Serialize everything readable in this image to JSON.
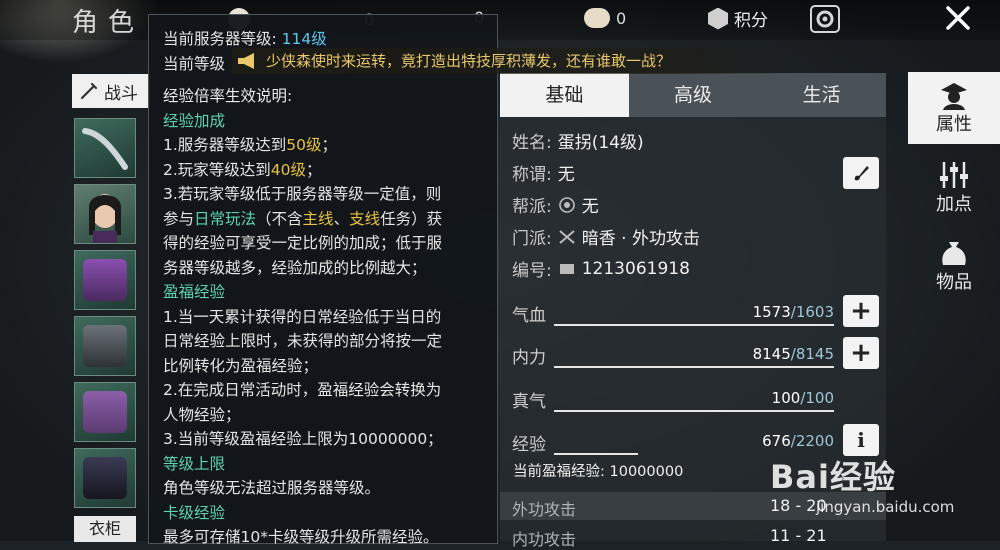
{
  "header": {
    "title": "角色",
    "resources": [
      {
        "name": "currency-1",
        "value": "0"
      },
      {
        "name": "currency-2",
        "value": "0"
      },
      {
        "name": "currency-3",
        "value": "0"
      }
    ],
    "jifen_label": "积分",
    "icons": {
      "points": "hexagon-icon",
      "settings": "gear-icon",
      "close": "close-icon"
    }
  },
  "left": {
    "battle_tab": "战斗",
    "wardrobe": "衣柜",
    "slots": [
      "weapon",
      "portrait",
      "headgear",
      "armor",
      "pants",
      "boots"
    ]
  },
  "banner": {
    "text": "少侠森使时来运转，竟打造出特技厚积薄发，还有谁敢一战？"
  },
  "tooltip": {
    "server_level_label": "当前服务器等级: ",
    "server_level_value": "114级",
    "current_level_label": "当前等级",
    "exp_title": "经验倍率生效说明:",
    "sections": {
      "bonus_title": "经验加成",
      "bonus_1_pre": "1.服务器等级达到",
      "bonus_1_val": "50级",
      "bonus_1_post": "；",
      "bonus_2_pre": "2.玩家等级达到",
      "bonus_2_val": "40级",
      "bonus_2_post": "；",
      "bonus_3_a": "3.若玩家等级低于服务器等级一定值，则",
      "bonus_3_b_pre": "参与",
      "bonus_3_b_hl1": "日常玩法",
      "bonus_3_b_mid": "（不含",
      "bonus_3_b_hl2": "主线",
      "bonus_3_b_sep": "、",
      "bonus_3_b_hl3": "支线",
      "bonus_3_b_post": "任务）获",
      "bonus_3_c": "得的经验可享受一定比例的加成；低于服",
      "bonus_3_d": "务器等级越多，经验加成的比例越大；",
      "yingfu_title": "盈福经验",
      "yingfu_1a": "1.当一天累计获得的日常经验低于当日的",
      "yingfu_1b": "日常经验上限时，未获得的部分将按一定",
      "yingfu_1c": "比例转化为盈福经验；",
      "yingfu_2a": "2.在完成日常活动时，盈福经验会转换为",
      "yingfu_2b": "人物经验；",
      "yingfu_3": "3.当前等级盈福经验上限为10000000；",
      "cap_title": "等级上限",
      "cap_text": "角色等级无法超过服务器等级。",
      "card_title": "卡级经验",
      "card_text": "最多可存储10*卡级等级升级所需经验。"
    }
  },
  "tabs": [
    "基础",
    "高级",
    "生活"
  ],
  "profile": {
    "name_label": "姓名: ",
    "name_value": "蛋拐(14级)",
    "title_label": "称谓: ",
    "title_value": "无",
    "guild_label": "帮派: ",
    "guild_value": "无",
    "sect_label": "门派: ",
    "sect_value": "暗香 · 外功攻击",
    "id_label": "编号: ",
    "id_value": "1213061918"
  },
  "stats": [
    {
      "label": "气血",
      "current": "1573",
      "max": "/1603",
      "button": "+"
    },
    {
      "label": "内力",
      "current": "8145",
      "max": "/8145",
      "button": "+"
    },
    {
      "label": "真气",
      "current": "100",
      "max": "/100"
    },
    {
      "label": "经验",
      "current": "676",
      "max": "/2200",
      "button": "i"
    }
  ],
  "bonus_exp": "当前盈福经验: 10000000",
  "attack_rows": [
    {
      "label": "外功攻击",
      "value": "18 - 20"
    },
    {
      "label": "内功攻击",
      "value": "11 - 21"
    }
  ],
  "side_menu": [
    {
      "label": "属性",
      "icon": "character-icon"
    },
    {
      "label": "加点",
      "icon": "sliders-icon"
    },
    {
      "label": "物品",
      "icon": "bag-icon"
    }
  ],
  "watermark": {
    "brand": "Bai经验",
    "url": "jingyan.baidu.com"
  },
  "colors": {
    "accent_blue": "#5cc6ea",
    "accent_teal": "#5dd3ad",
    "accent_gold": "#e8c23d"
  }
}
